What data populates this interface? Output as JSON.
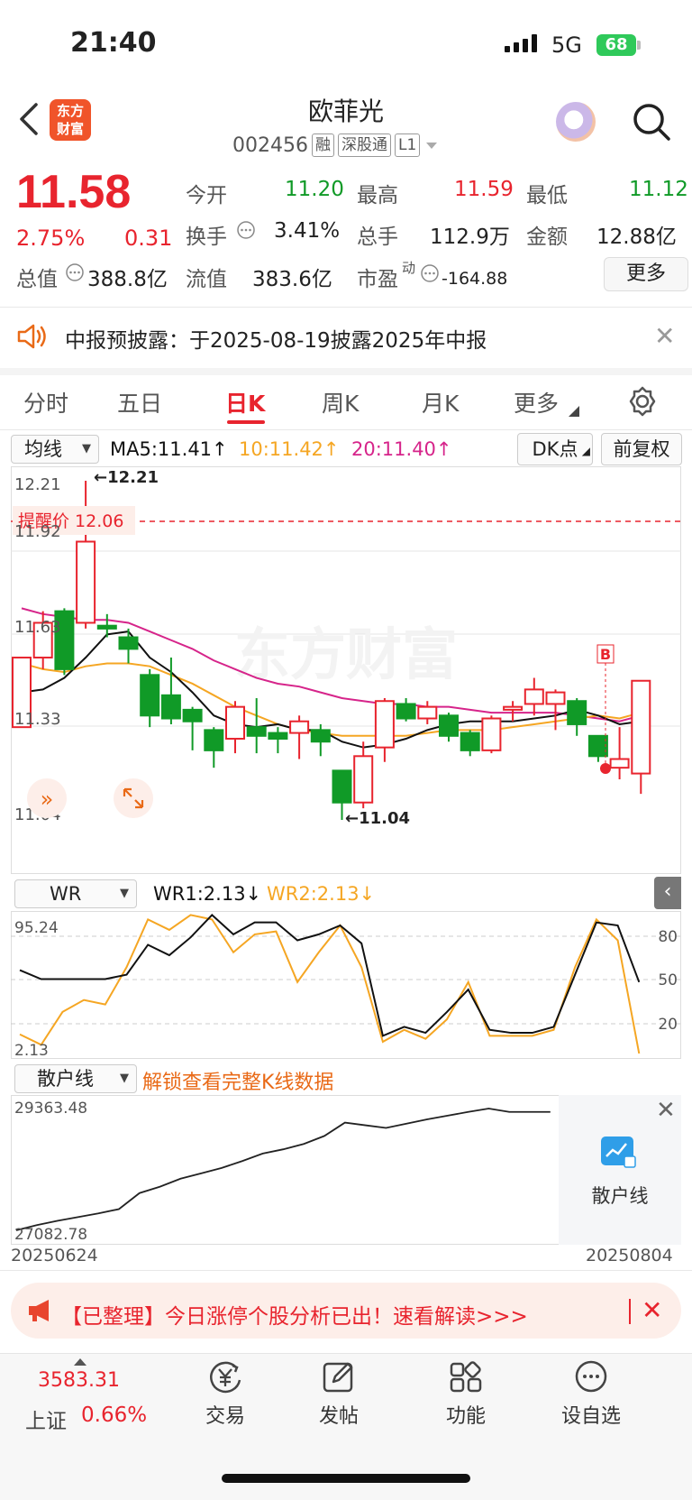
{
  "status": {
    "time": "21:40",
    "network": "5G",
    "battery": "68"
  },
  "header": {
    "logo_line1": "东方",
    "logo_line2": "财富",
    "name": "欧菲光",
    "code": "002456",
    "tags": [
      "融",
      "深股通",
      "L1"
    ]
  },
  "quote": {
    "price": "11.58",
    "pct": "2.75%",
    "change": "0.31",
    "open_label": "今开",
    "open": "11.20",
    "high_label": "最高",
    "high": "11.59",
    "low_label": "最低",
    "low": "11.12",
    "turnover_label": "换手",
    "turnover": "3.41%",
    "volume_label": "总手",
    "volume": "112.9万",
    "amount_label": "金额",
    "amount": "12.88亿",
    "mktcap_label": "总值",
    "mktcap": "388.8亿",
    "float_label": "流值",
    "float": "383.6亿",
    "pe_label": "市盈",
    "pe_sup": "动",
    "pe": "-164.88",
    "more": "更多"
  },
  "notice": {
    "text": "中报预披露：于2025-08-19披露2025年中报"
  },
  "tabs": [
    "分时",
    "五日",
    "日K",
    "周K",
    "月K",
    "更多"
  ],
  "ma": {
    "select": "均线",
    "ma5": "MA5:11.41↑",
    "ma10": "10:11.42↑",
    "ma20": "20:11.40↑",
    "dk": "DK点",
    "fq": "前复权"
  },
  "kline": {
    "y_labels": [
      "12.21",
      "11.92",
      "11.63",
      "11.33",
      "11.04"
    ],
    "alert": "提醒价 12.06",
    "max_mark": "←12.21",
    "min_mark": "←11.04",
    "watermark": "东方财富",
    "b_mark": "B"
  },
  "wr": {
    "select": "WR",
    "wr1": "WR1:2.13↓",
    "wr2": "WR2:2.13↓",
    "y_left_top": "95.24",
    "y_left_bottom": "2.13",
    "y_right": [
      "80",
      "50",
      "20"
    ]
  },
  "retail": {
    "select": "散户线",
    "unlock": "解锁查看完整K线数据",
    "top": "29363.48",
    "bottom": "27082.78",
    "panel_label": "散户线",
    "date_start": "20250624",
    "date_end": "20250804"
  },
  "banner": {
    "text": "【已整理】今日涨停个股分析已出！速看解读>>>"
  },
  "index": {
    "value": "3583.31",
    "name": "上证",
    "pct": "0.66%"
  },
  "nav": [
    "交易",
    "发帖",
    "功能",
    "设自选"
  ],
  "colors": {
    "up": "#e8242e",
    "down": "#109a27",
    "ma5": "#111111",
    "ma10": "#f5a623",
    "ma20": "#d6248a"
  },
  "chart_data": {
    "type": "candlestick",
    "y_range": [
      11.04,
      12.21
    ],
    "candles": [
      {
        "o": 11.36,
        "c": 11.6,
        "h": 11.6,
        "l": 11.36
      },
      {
        "o": 11.6,
        "c": 11.72,
        "h": 11.76,
        "l": 11.56
      },
      {
        "o": 11.76,
        "c": 11.56,
        "h": 11.77,
        "l": 11.54
      },
      {
        "o": 11.72,
        "c": 12.0,
        "h": 12.21,
        "l": 11.7
      },
      {
        "o": 11.71,
        "c": 11.7,
        "h": 11.75,
        "l": 11.67
      },
      {
        "o": 11.67,
        "c": 11.63,
        "h": 11.7,
        "l": 11.58
      },
      {
        "o": 11.54,
        "c": 11.4,
        "h": 11.56,
        "l": 11.36
      },
      {
        "o": 11.47,
        "c": 11.39,
        "h": 11.6,
        "l": 11.37
      },
      {
        "o": 11.42,
        "c": 11.38,
        "h": 11.43,
        "l": 11.28
      },
      {
        "o": 11.35,
        "c": 11.28,
        "h": 11.36,
        "l": 11.22
      },
      {
        "o": 11.32,
        "c": 11.43,
        "h": 11.45,
        "l": 11.27
      },
      {
        "o": 11.36,
        "c": 11.33,
        "h": 11.46,
        "l": 11.27
      },
      {
        "o": 11.34,
        "c": 11.32,
        "h": 11.36,
        "l": 11.27
      },
      {
        "o": 11.34,
        "c": 11.38,
        "h": 11.4,
        "l": 11.25
      },
      {
        "o": 11.35,
        "c": 11.31,
        "h": 11.37,
        "l": 11.26
      },
      {
        "o": 11.21,
        "c": 11.1,
        "h": 11.21,
        "l": 11.04
      },
      {
        "o": 11.1,
        "c": 11.26,
        "h": 11.31,
        "l": 11.08
      },
      {
        "o": 11.29,
        "c": 11.45,
        "h": 11.46,
        "l": 11.24
      },
      {
        "o": 11.44,
        "c": 11.39,
        "h": 11.46,
        "l": 11.38
      },
      {
        "o": 11.39,
        "c": 11.43,
        "h": 11.45,
        "l": 11.37
      },
      {
        "o": 11.4,
        "c": 11.33,
        "h": 11.41,
        "l": 11.31
      },
      {
        "o": 11.34,
        "c": 11.28,
        "h": 11.35,
        "l": 11.26
      },
      {
        "o": 11.28,
        "c": 11.39,
        "h": 11.4,
        "l": 11.27
      },
      {
        "o": 11.42,
        "c": 11.43,
        "h": 11.45,
        "l": 11.38
      },
      {
        "o": 11.44,
        "c": 11.49,
        "h": 11.53,
        "l": 11.4
      },
      {
        "o": 11.44,
        "c": 11.48,
        "h": 11.49,
        "l": 11.35
      },
      {
        "o": 11.45,
        "c": 11.37,
        "h": 11.46,
        "l": 11.33
      },
      {
        "o": 11.33,
        "c": 11.26,
        "h": 11.33,
        "l": 11.24
      },
      {
        "o": 11.22,
        "c": 11.25,
        "h": 11.36,
        "l": 11.18
      },
      {
        "o": 11.2,
        "c": 11.52,
        "h": 11.52,
        "l": 11.13
      }
    ],
    "ma5": [
      11.48,
      11.49,
      11.53,
      11.6,
      11.68,
      11.69,
      11.6,
      11.55,
      11.48,
      11.4,
      11.37,
      11.36,
      11.37,
      11.35,
      11.35,
      11.31,
      11.29,
      11.3,
      11.32,
      11.35,
      11.37,
      11.38,
      11.38,
      11.38,
      11.39,
      11.4,
      11.42,
      11.4,
      11.37,
      11.38
    ],
    "ma10": [
      11.58,
      11.56,
      11.55,
      11.57,
      11.58,
      11.58,
      11.57,
      11.54,
      11.51,
      11.47,
      11.43,
      11.4,
      11.37,
      11.35,
      11.34,
      11.33,
      11.33,
      11.33,
      11.33,
      11.34,
      11.35,
      11.35,
      11.35,
      11.36,
      11.37,
      11.38,
      11.39,
      11.4,
      11.39,
      11.41
    ],
    "ma20": [
      11.77,
      11.75,
      11.74,
      11.73,
      11.73,
      11.72,
      11.69,
      11.66,
      11.63,
      11.59,
      11.56,
      11.53,
      11.51,
      11.5,
      11.48,
      11.46,
      11.45,
      11.44,
      11.44,
      11.43,
      11.43,
      11.42,
      11.41,
      11.41,
      11.41,
      11.41,
      11.4,
      11.39,
      11.38,
      11.4
    ],
    "wr1": [
      58,
      52,
      52,
      52,
      52,
      55,
      75,
      68,
      80,
      95,
      82,
      90,
      90,
      78,
      82,
      88,
      76,
      14,
      20,
      16,
      30,
      45,
      18,
      16,
      16,
      20,
      55,
      90,
      88,
      50
    ],
    "wr2": [
      15,
      8,
      30,
      38,
      35,
      60,
      92,
      85,
      95,
      92,
      70,
      82,
      84,
      50,
      70,
      88,
      60,
      10,
      18,
      12,
      25,
      50,
      14,
      14,
      14,
      18,
      60,
      92,
      78,
      2.13
    ],
    "wr_range": [
      2.13,
      95.24
    ],
    "retail": [
      27082.78,
      27180,
      27260,
      27330,
      27400,
      27480,
      27780,
      27900,
      28050,
      28150,
      28250,
      28380,
      28520,
      28600,
      28700,
      28850,
      29100,
      29050,
      29000,
      29080,
      29160,
      29230,
      29300,
      29363.48,
      29300,
      29300,
      29300
    ],
    "retail_range": [
      27082.78,
      29363.48
    ]
  }
}
